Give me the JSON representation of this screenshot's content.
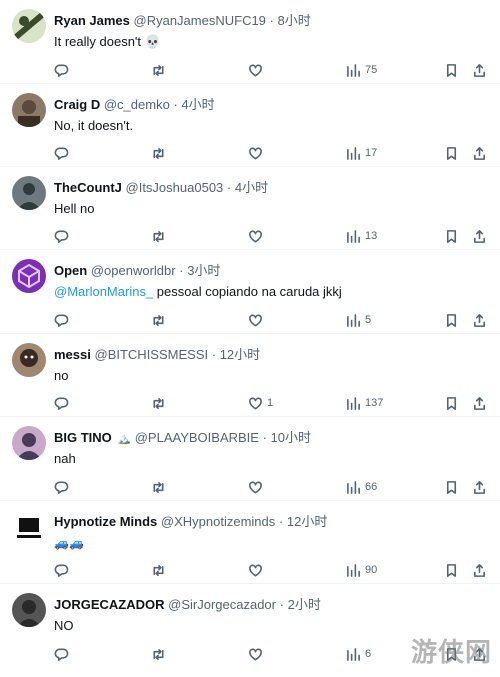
{
  "tweets": [
    {
      "name": "Ryan James",
      "badge": "",
      "handle": "@RyanJamesNUFC19",
      "time": "8小时",
      "text": "It really doesn't 💀",
      "extra": "",
      "mention": "",
      "likes": "",
      "views": "75",
      "avatar_color": "#3b4a2a"
    },
    {
      "name": "Craig D",
      "badge": "",
      "handle": "@c_demko",
      "time": "4小时",
      "text": "No, it doesn't.",
      "extra": "",
      "mention": "",
      "likes": "",
      "views": "17",
      "avatar_color": "#5a4a3a"
    },
    {
      "name": "TheCountJ",
      "badge": "",
      "handle": "@ItsJoshua0503",
      "time": "4小时",
      "text": "Hell no",
      "extra": "",
      "mention": "",
      "likes": "",
      "views": "13",
      "avatar_color": "#2f3a3f"
    },
    {
      "name": "Open",
      "badge": "",
      "handle": "@openworldbr",
      "time": "3小时",
      "text": " pessoal copiando na caruda jkkj",
      "extra": "",
      "mention": "@MarlonMarins_",
      "likes": "",
      "views": "5",
      "avatar_color": "#7b2fb5"
    },
    {
      "name": "messi",
      "badge": "",
      "handle": "@BITCHISSMESSI",
      "time": "12小时",
      "text": "no",
      "extra": "",
      "mention": "",
      "likes": "1",
      "views": "137",
      "avatar_color": "#3a2a22"
    },
    {
      "name": "BIG TINO",
      "badge": "🏔️",
      "handle": "@PLAAYBOIBARBIE",
      "time": "10小时",
      "text": "nah",
      "extra": "",
      "mention": "",
      "likes": "",
      "views": "66",
      "avatar_color": "#4a3a5a"
    },
    {
      "name": "Hypnotize Minds",
      "badge": "",
      "handle": "@XHypnotizeminds",
      "time": "12小时",
      "text": "",
      "extra": "🚙🚙",
      "mention": "",
      "likes": "",
      "views": "90",
      "avatar_color": "#111111"
    },
    {
      "name": "JORGECAZADOR",
      "badge": "",
      "handle": "@SirJorgecazador",
      "time": "2小时",
      "text": "NO",
      "extra": "",
      "mention": "",
      "likes": "",
      "views": "6",
      "avatar_color": "#2a2a2a"
    }
  ],
  "watermark": "游侠网",
  "icons": {
    "reply": "reply-icon",
    "retweet": "retweet-icon",
    "like": "heart-icon",
    "views": "views-icon",
    "bookmark": "bookmark-icon",
    "share": "share-icon"
  }
}
